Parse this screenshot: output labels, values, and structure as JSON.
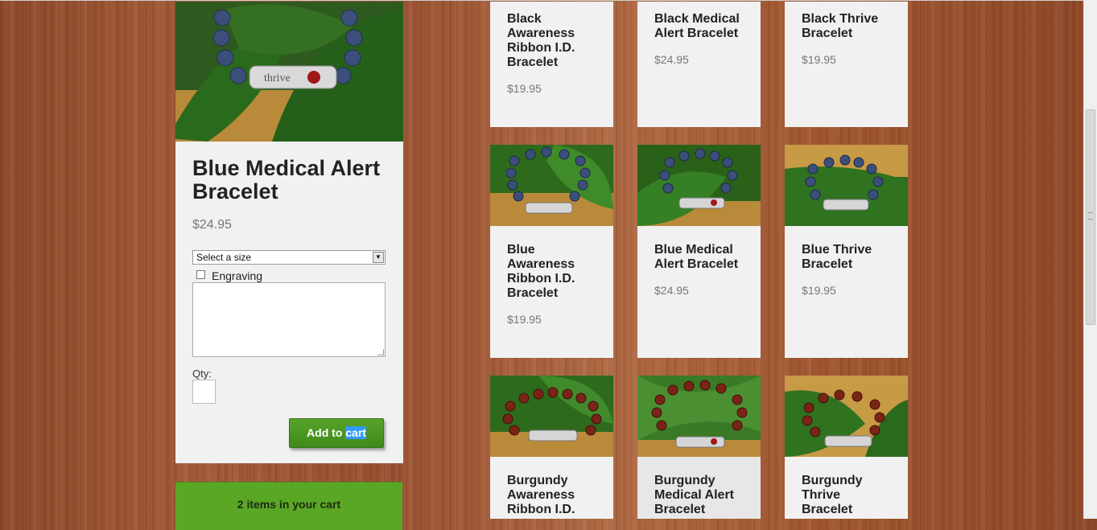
{
  "detail": {
    "title": "Blue Medical Alert Bracelet",
    "price": "$24.95",
    "size_select": "Select a size",
    "engraving_label": "Engraving",
    "qty_label": "Qty:",
    "add_to_cart_prefix": "Add to ",
    "add_to_cart_selected": "cart"
  },
  "cart": {
    "summary": "2 items in your cart"
  },
  "products": [
    {
      "name": "Black Awareness Ribbon I.D. Bracelet",
      "price": "$19.95"
    },
    {
      "name": "Black Medical Alert Bracelet",
      "price": "$24.95"
    },
    {
      "name": "Black Thrive Bracelet",
      "price": "$19.95"
    },
    {
      "name": "Blue Awareness Ribbon I.D. Bracelet",
      "price": "$19.95"
    },
    {
      "name": "Blue Medical Alert Bracelet",
      "price": "$24.95"
    },
    {
      "name": "Blue Thrive Bracelet",
      "price": "$19.95"
    },
    {
      "name": "Burgundy Awareness Ribbon I.D.",
      "price": ""
    },
    {
      "name": "Burgundy Medical Alert Bracelet",
      "price": ""
    },
    {
      "name": "Burgundy Thrive Bracelet",
      "price": ""
    }
  ],
  "colors": {
    "card_bg": "#f1f1f1",
    "add_to_cart": "#4a9622",
    "cart_bar": "#5aa725",
    "price_text": "#777777",
    "bead_blue": "#3b4f7a",
    "bead_burgundy": "#7a2418",
    "leaf": "#2e6a1c"
  },
  "icons": {
    "select_arrow": "chevron-down-icon",
    "checkbox": "checkbox-icon"
  }
}
